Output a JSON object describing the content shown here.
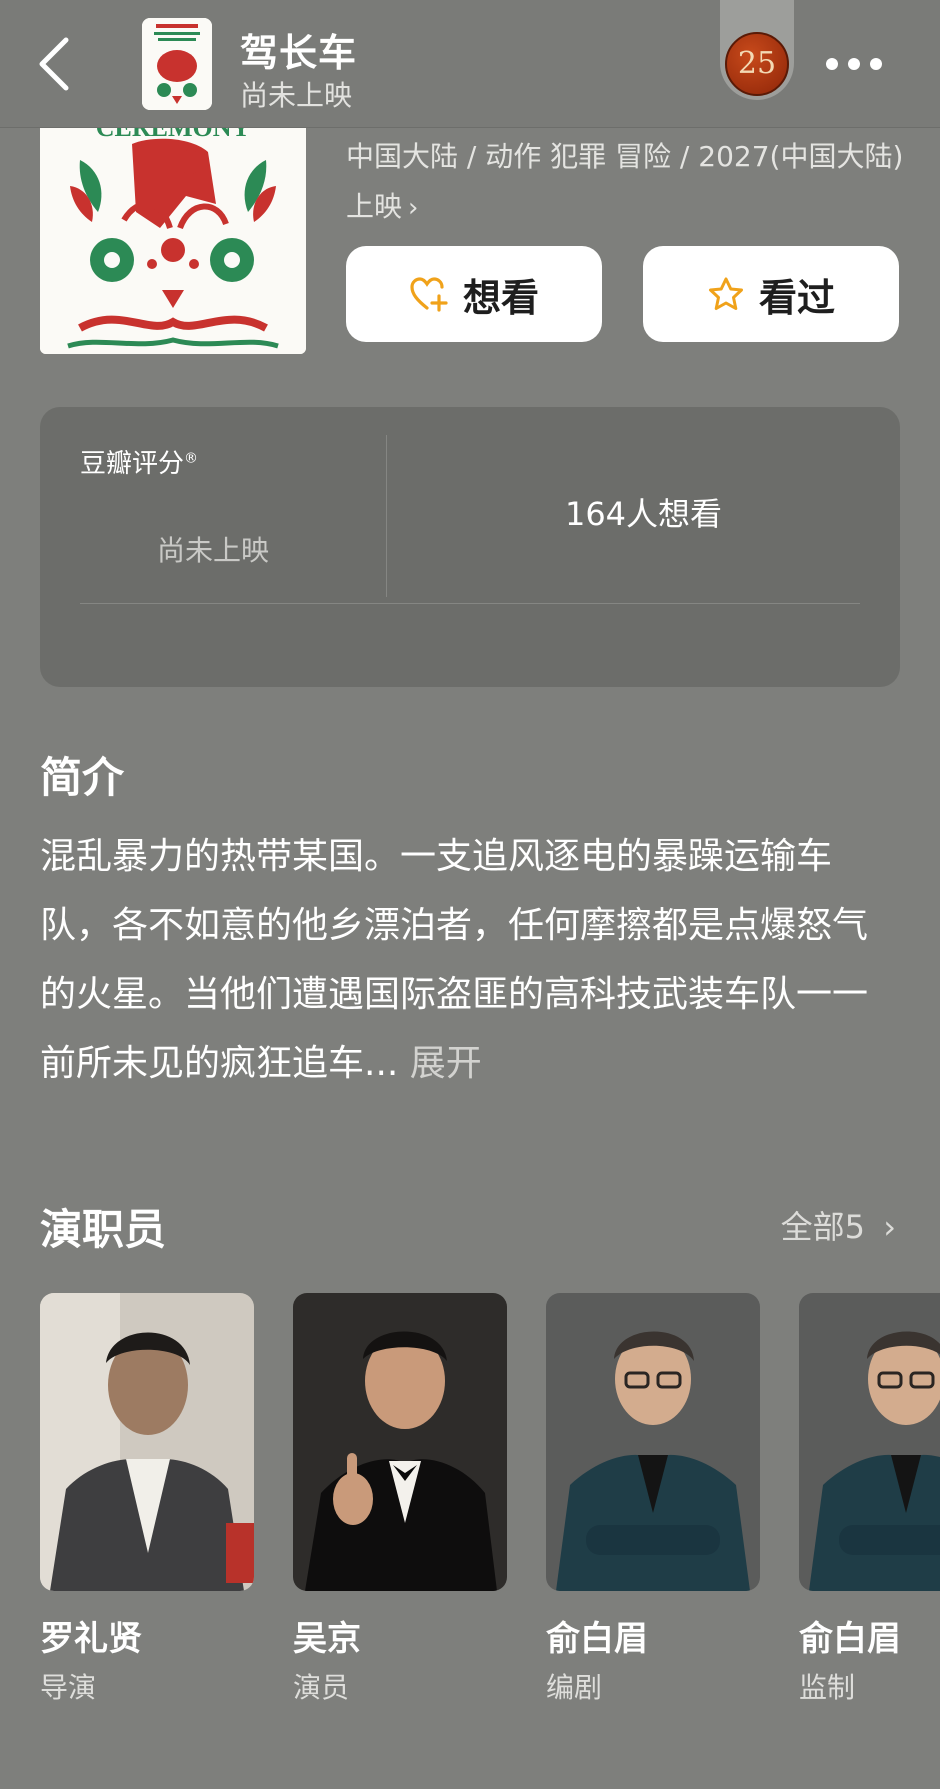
{
  "nav": {
    "title": "驾长车",
    "subtitle": "尚未上映",
    "badge_number": "25"
  },
  "movie": {
    "meta": "中国大陆 / 动作 犯罪 冒险 / 2027(中国大陆)上映",
    "meta_chevron": "›",
    "poster_text": "CEREMONY"
  },
  "actions": {
    "want_label": "想看",
    "seen_label": "看过"
  },
  "rating": {
    "title": "豆瓣评分",
    "title_mark": "®",
    "empty_text": "尚未上映",
    "want_count": "164人想看"
  },
  "synopsis": {
    "heading": "简介",
    "text": "混乱暴力的热带某国。一支追风逐电的暴躁运输车队，各不如意的他乡漂泊者，任何摩擦都是点爆怒气的火星。当他们遭遇国际盗匪的高科技武装车队一一前所未见的疯狂追车...",
    "expand_label": "展开"
  },
  "cast": {
    "heading": "演职员",
    "all_label": "全部5",
    "all_chevron": "›",
    "members": [
      {
        "name": "罗礼贤",
        "role": "导演"
      },
      {
        "name": "吴京",
        "role": "演员"
      },
      {
        "name": "俞白眉",
        "role": "编剧"
      },
      {
        "name": "俞白眉",
        "role": "监制"
      }
    ]
  },
  "colors": {
    "background": "#7e7f7c",
    "card": "#6c6d6a",
    "button_bg": "#ffffff",
    "icon_accent": "#f0a21a"
  }
}
